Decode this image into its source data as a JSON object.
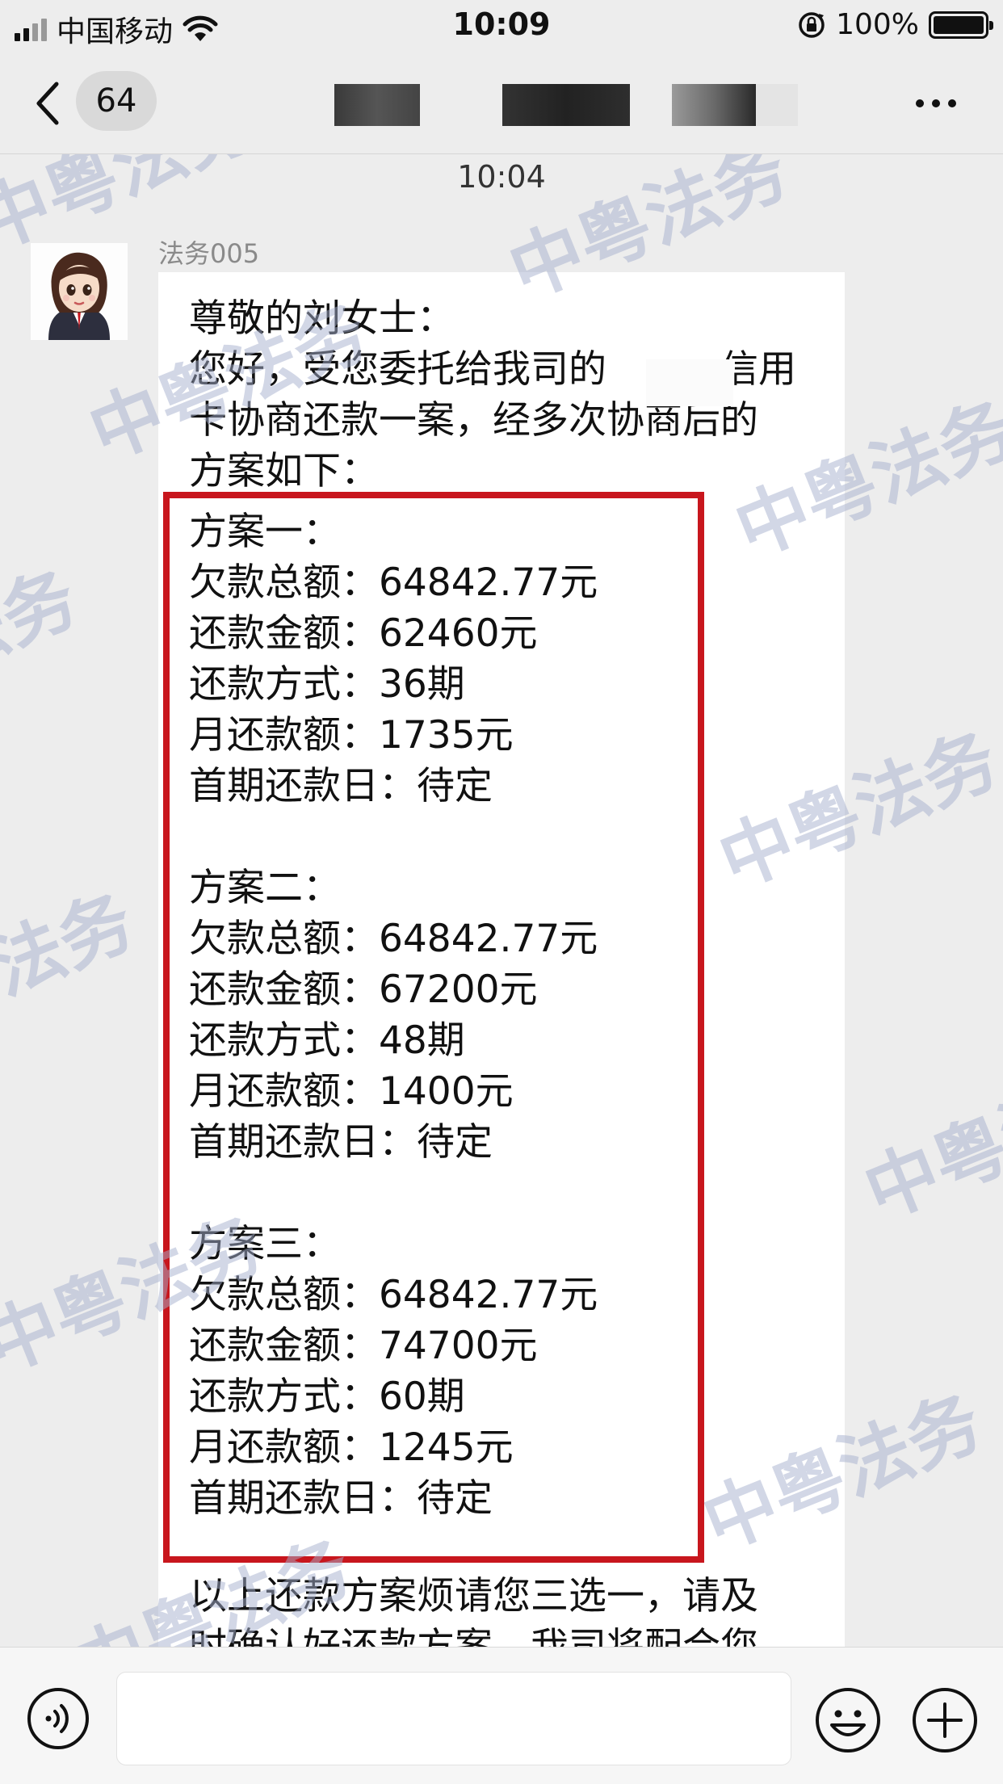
{
  "status_bar": {
    "carrier": "中国移动",
    "time": "10:09",
    "battery": "100%",
    "battery_level": 1.0
  },
  "nav": {
    "unread_count": "64"
  },
  "chat": {
    "timestamp": "10:04",
    "sender_name": "法务005",
    "watermark_text": "中粤法务",
    "message": {
      "greeting": "尊敬的刘女士：\n您好，受您委托给我司的　　　信用\n卡协商还款一案，经多次协商后的\n方案如下：",
      "plans": "方案一：\n欠款总额：64842.77元\n还款金额：62460元\n还款方式：36期\n月还款额：1735元\n首期还款日：待定\n\n方案二：\n欠款总额：64842.77元\n还款金额：67200元\n还款方式：48期\n月还款额：1400元\n首期还款日：待定\n\n方案三：\n欠款总额：64842.77元\n还款金额：74700元\n还款方式：60期\n月还款额：1245元\n首期还款日：待定",
      "footer": "以上还款方案烦请您三选一，请及\n时确认好还款方案，我司将配合您"
    }
  },
  "colors": {
    "highlight_border": "#c8161d",
    "watermark": "#a5afcd",
    "background": "#ededed"
  },
  "icons": {
    "back": "chevron-left-icon",
    "more": "more-dots-icon",
    "voice": "voice-icon",
    "emoji": "emoji-icon",
    "plus": "plus-icon"
  }
}
